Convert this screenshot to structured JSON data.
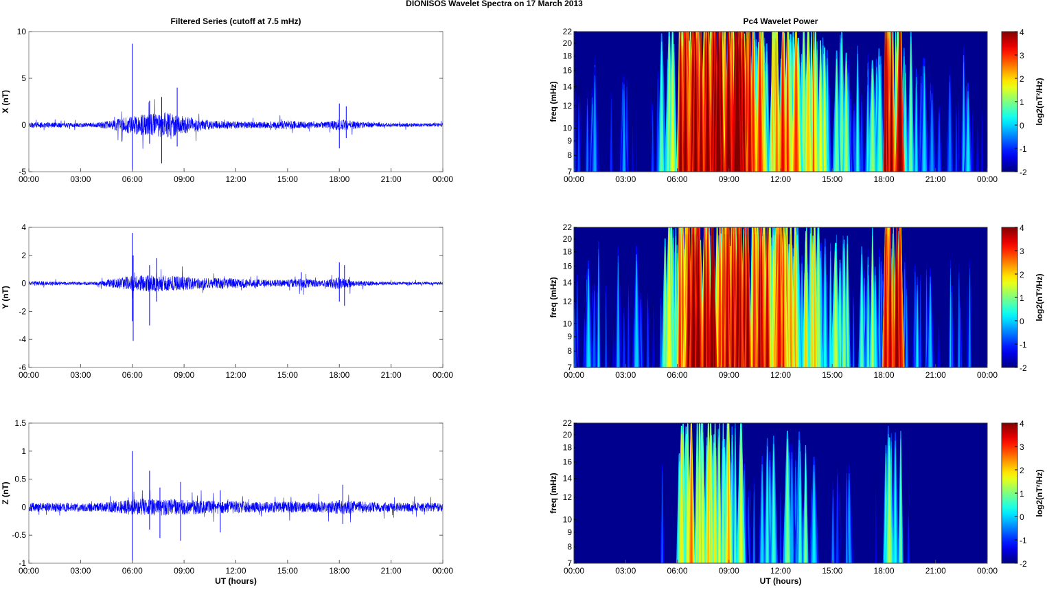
{
  "title": "DIONISOS Wavelet Spectra on 17 March     2013",
  "chart_data": [
    {
      "type": "line",
      "panel": "left",
      "title": "Filtered Series (cutoff at 7.5 mHz)",
      "ylabel": "X (nT)",
      "xlabel": "",
      "ylim": [
        -5,
        10
      ],
      "yticks": [
        "-5",
        "0",
        "5",
        "10"
      ],
      "ytick_values": [
        -5,
        0,
        5,
        10
      ],
      "xticks": [
        "00:00",
        "03:00",
        "06:00",
        "09:00",
        "12:00",
        "15:00",
        "18:00",
        "21:00",
        "00:00"
      ],
      "xlim_hours": [
        0,
        24
      ],
      "envelope_hour": [
        0.3,
        0.3,
        0.25,
        0.25,
        0.25,
        0.6,
        1.0,
        1.2,
        1.4,
        1.0,
        0.6,
        0.45,
        0.4,
        0.35,
        0.35,
        0.5,
        0.35,
        0.3,
        0.6,
        0.4,
        0.25,
        0.2,
        0.2,
        0.2,
        0.2
      ],
      "spikes": [
        {
          "t": 6.0,
          "max": 8.7,
          "min": -4.8
        },
        {
          "t": 7.0,
          "max": 2.6,
          "min": -2.0
        },
        {
          "t": 7.7,
          "max": 3.0,
          "min": -4.1
        },
        {
          "t": 8.6,
          "max": 4.0,
          "min": -2.3
        },
        {
          "t": 18.0,
          "max": 2.3,
          "min": -2.5
        },
        {
          "t": 18.4,
          "max": 2.0,
          "min": -1.4
        }
      ],
      "color": "#0000ff",
      "seed": 11
    },
    {
      "type": "heatmap",
      "panel": "right",
      "title": "Pc4 Wavelet Power",
      "ylabel": "freq (mHz)",
      "xlabel": "",
      "ylim": [
        7,
        22
      ],
      "yscale": "log",
      "yticks": [
        "7",
        "8",
        "9",
        "10",
        "12",
        "14",
        "16",
        "18",
        "20",
        "22"
      ],
      "ytick_values": [
        7,
        8,
        9,
        10,
        12,
        14,
        16,
        18,
        20,
        22
      ],
      "xticks": [
        "00:00",
        "03:00",
        "06:00",
        "09:00",
        "12:00",
        "15:00",
        "18:00",
        "21:00",
        "00:00"
      ],
      "clim": [
        -2,
        4
      ],
      "cticks": [
        "-2",
        "-1",
        "0",
        "1",
        "2",
        "3",
        "4"
      ],
      "cbar_label": "log2(nT²/Hz)",
      "activity_hour": [
        0.2,
        -0.3,
        -0.5,
        -0.5,
        -0.8,
        1.8,
        4.0,
        4.0,
        4.5,
        4.2,
        3.2,
        2.8,
        3.0,
        2.2,
        1.4,
        1.0,
        0.2,
        1.2,
        3.8,
        0.6,
        -0.6,
        -0.8,
        -0.2,
        -1.5
      ],
      "seed": 21
    },
    {
      "type": "line",
      "panel": "left",
      "title": "",
      "ylabel": "Y (nT)",
      "xlabel": "",
      "ylim": [
        -6,
        4
      ],
      "yticks": [
        "-6",
        "-4",
        "-2",
        "0",
        "2",
        "4"
      ],
      "ytick_values": [
        -6,
        -4,
        -2,
        0,
        2,
        4
      ],
      "xticks": [
        "00:00",
        "03:00",
        "06:00",
        "09:00",
        "12:00",
        "15:00",
        "18:00",
        "21:00",
        "00:00"
      ],
      "xlim_hours": [
        0,
        24
      ],
      "envelope_hour": [
        0.15,
        0.15,
        0.12,
        0.12,
        0.12,
        0.35,
        0.55,
        0.6,
        0.55,
        0.5,
        0.35,
        0.4,
        0.35,
        0.3,
        0.25,
        0.25,
        0.35,
        0.2,
        0.45,
        0.2,
        0.15,
        0.12,
        0.1,
        0.1,
        0.1
      ],
      "spikes": [
        {
          "t": 6.0,
          "max": 3.6,
          "min": -2.7
        },
        {
          "t": 6.05,
          "max": 2.0,
          "min": -4.1
        },
        {
          "t": 7.0,
          "max": 1.3,
          "min": -3.0
        },
        {
          "t": 7.4,
          "max": 1.8,
          "min": -1.3
        },
        {
          "t": 15.8,
          "max": 0.8,
          "min": -0.5
        },
        {
          "t": 18.0,
          "max": 1.5,
          "min": -1.3
        },
        {
          "t": 18.3,
          "max": 1.3,
          "min": -1.6
        }
      ],
      "color": "#0000ff",
      "seed": 33
    },
    {
      "type": "heatmap",
      "panel": "right",
      "title": "",
      "ylabel": "freq (mHz)",
      "xlabel": "",
      "ylim": [
        7,
        22
      ],
      "yscale": "log",
      "yticks": [
        "7",
        "8",
        "9",
        "10",
        "12",
        "14",
        "16",
        "18",
        "20",
        "22"
      ],
      "ytick_values": [
        7,
        8,
        9,
        10,
        12,
        14,
        16,
        18,
        20,
        22
      ],
      "xticks": [
        "00:00",
        "03:00",
        "06:00",
        "09:00",
        "12:00",
        "15:00",
        "18:00",
        "21:00",
        "00:00"
      ],
      "clim": [
        -2,
        4
      ],
      "cticks": [
        "-2",
        "-1",
        "0",
        "1",
        "2",
        "3",
        "4"
      ],
      "cbar_label": "log2(nT²/Hz)",
      "activity_hour": [
        0.0,
        -0.4,
        -0.6,
        -0.6,
        -0.8,
        1.6,
        4.0,
        4.0,
        4.2,
        4.0,
        3.4,
        3.2,
        3.0,
        2.2,
        1.2,
        1.6,
        0.4,
        0.8,
        3.6,
        0.0,
        -0.6,
        -0.4,
        -0.5,
        -1.5
      ],
      "seed": 42
    },
    {
      "type": "line",
      "panel": "left",
      "title": "",
      "ylabel": "Z (nT)",
      "xlabel": "UT (hours)",
      "ylim": [
        -1,
        1.5
      ],
      "yticks": [
        "-1",
        "-0.5",
        "0",
        "0.5",
        "1",
        "1.5"
      ],
      "ytick_values": [
        -1,
        -0.5,
        0,
        0.5,
        1,
        1.5
      ],
      "xticks": [
        "00:00",
        "03:00",
        "06:00",
        "09:00",
        "12:00",
        "15:00",
        "18:00",
        "21:00",
        "00:00"
      ],
      "xlim_hours": [
        0,
        24
      ],
      "envelope_hour": [
        0.08,
        0.08,
        0.08,
        0.08,
        0.08,
        0.1,
        0.14,
        0.16,
        0.15,
        0.14,
        0.12,
        0.11,
        0.11,
        0.1,
        0.1,
        0.1,
        0.1,
        0.1,
        0.13,
        0.11,
        0.09,
        0.08,
        0.08,
        0.08,
        0.08
      ],
      "spikes": [
        {
          "t": 6.0,
          "max": 1.0,
          "min": -0.95
        },
        {
          "t": 7.0,
          "max": 0.65,
          "min": -0.4
        },
        {
          "t": 7.6,
          "max": 0.35,
          "min": -0.55
        },
        {
          "t": 8.8,
          "max": 0.45,
          "min": -0.6
        },
        {
          "t": 11.1,
          "max": 0.3,
          "min": -0.45
        },
        {
          "t": 18.2,
          "max": 0.4,
          "min": -0.3
        }
      ],
      "color": "#0000ff",
      "seed": 55
    },
    {
      "type": "heatmap",
      "panel": "right",
      "title": "",
      "ylabel": "freq (mHz)",
      "xlabel": "UT (hours)",
      "ylim": [
        7,
        22
      ],
      "yscale": "log",
      "yticks": [
        "7",
        "8",
        "9",
        "10",
        "12",
        "14",
        "16",
        "18",
        "20",
        "22"
      ],
      "ytick_values": [
        7,
        8,
        9,
        10,
        12,
        14,
        16,
        18,
        20,
        22
      ],
      "xticks": [
        "00:00",
        "03:00",
        "06:00",
        "09:00",
        "12:00",
        "15:00",
        "18:00",
        "21:00",
        "00:00"
      ],
      "clim": [
        -2,
        4
      ],
      "cticks": [
        "-2",
        "-1",
        "0",
        "1",
        "2",
        "3",
        "4"
      ],
      "cbar_label": "log2(nT²/Hz)",
      "activity_hour": [
        -2,
        -2,
        -2,
        -2,
        -2,
        -1.5,
        2.5,
        1.8,
        2.0,
        1.2,
        -0.2,
        0.2,
        0.8,
        0.6,
        -1.5,
        -0.2,
        -1.8,
        -1.5,
        1.0,
        -0.6,
        -2,
        -2,
        -2,
        -2
      ],
      "seed": 77
    }
  ]
}
